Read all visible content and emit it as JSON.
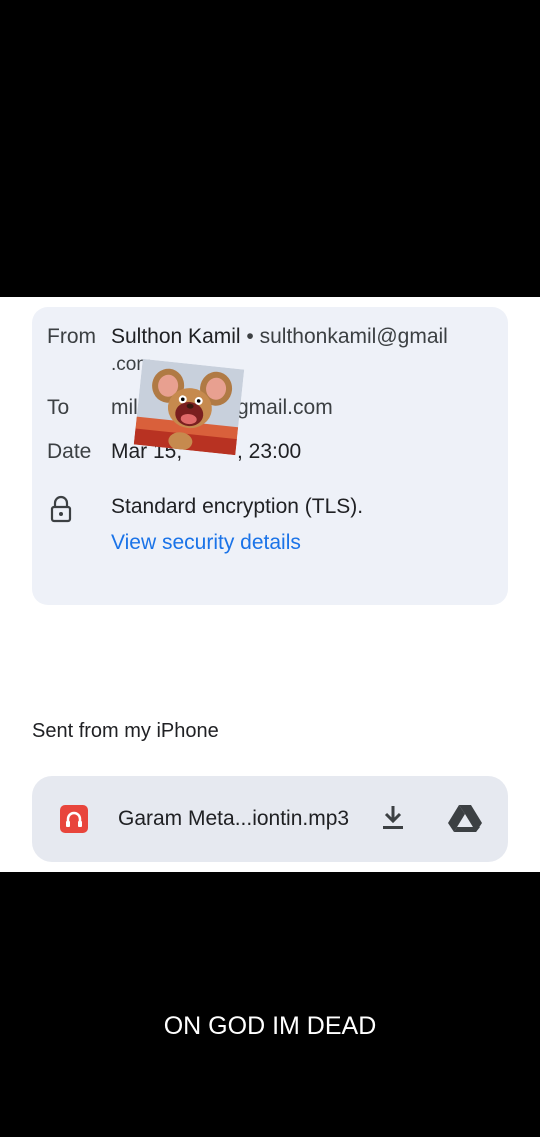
{
  "email": {
    "from_label": "From",
    "sender_name": "Sulthon Kamil",
    "sender_separator": "•",
    "sender_email": "sulthonkamil@gmail",
    "sender_email_cont": ".com",
    "to_label": "To",
    "to_value_start": "mill",
    "to_value_end": "gmail.com",
    "date_label": "Date",
    "date_value_start": "Mar 15,",
    "date_value_end": ", 23:00",
    "encryption_text": "Standard encryption (TLS).",
    "security_link": "View security details",
    "body_text": "Sent from my iPhone"
  },
  "attachment": {
    "name": "Garam Meta...iontin.mp3",
    "icon": "audio-file-icon",
    "actions": [
      "download-icon",
      "drive-icon"
    ]
  },
  "overlay": {
    "sticker": "jerry-mouse-sticker",
    "caption": "ON GOD IM DEAD"
  },
  "colors": {
    "link": "#1a73e8",
    "card": "#eef1f8",
    "audio_icon": "#e8453c"
  }
}
